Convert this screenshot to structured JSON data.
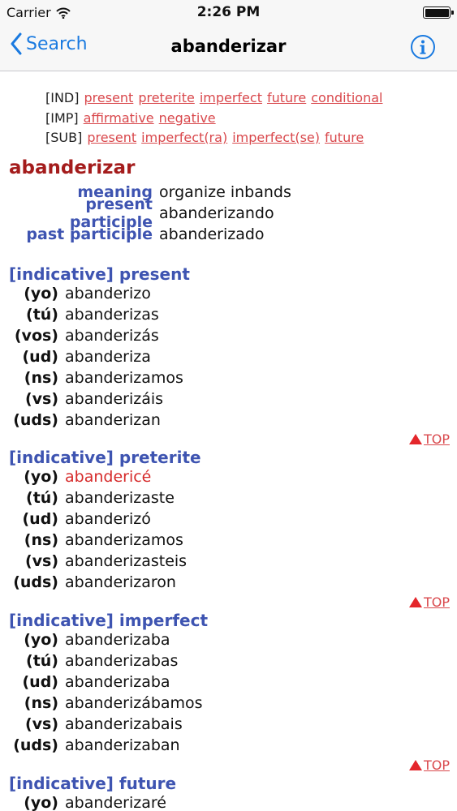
{
  "status_bar": {
    "carrier": "Carrier",
    "time": "2:26 PM"
  },
  "nav": {
    "back_label": "Search",
    "title": "abanderizar"
  },
  "quick_links": [
    {
      "tag": "[IND]",
      "links": [
        "present",
        "preterite",
        "imperfect",
        "future",
        "conditional"
      ]
    },
    {
      "tag": "[IMP]",
      "links": [
        "affirmative",
        "negative"
      ]
    },
    {
      "tag": "[SUB]",
      "links": [
        "present",
        "imperfect(ra)",
        "imperfect(se)",
        "future"
      ]
    }
  ],
  "verb": {
    "title": "abanderizar",
    "info": [
      {
        "label": "meaning",
        "value": "organize inbands"
      },
      {
        "label": "present participle",
        "value": "abanderizando"
      },
      {
        "label": "past participle",
        "value": "abanderizado"
      }
    ]
  },
  "sections": [
    {
      "header": "[indicative] present",
      "rows": [
        {
          "pronoun": "(yo)",
          "form": "abanderizo"
        },
        {
          "pronoun": "(tú)",
          "form": "abanderizas"
        },
        {
          "pronoun": "(vos)",
          "form": "abanderizás"
        },
        {
          "pronoun": "(ud)",
          "form": "abanderiza"
        },
        {
          "pronoun": "(ns)",
          "form": "abanderizamos"
        },
        {
          "pronoun": "(vs)",
          "form": "abanderizáis"
        },
        {
          "pronoun": "(uds)",
          "form": "abanderizan"
        }
      ]
    },
    {
      "header": "[indicative] preterite",
      "rows": [
        {
          "pronoun": "(yo)",
          "form": "abandericé",
          "irregular": true
        },
        {
          "pronoun": "(tú)",
          "form": "abanderizaste"
        },
        {
          "pronoun": "(ud)",
          "form": "abanderizó"
        },
        {
          "pronoun": "(ns)",
          "form": "abanderizamos"
        },
        {
          "pronoun": "(vs)",
          "form": "abanderizasteis"
        },
        {
          "pronoun": "(uds)",
          "form": "abanderizaron"
        }
      ]
    },
    {
      "header": "[indicative] imperfect",
      "rows": [
        {
          "pronoun": "(yo)",
          "form": "abanderizaba"
        },
        {
          "pronoun": "(tú)",
          "form": "abanderizabas"
        },
        {
          "pronoun": "(ud)",
          "form": "abanderizaba"
        },
        {
          "pronoun": "(ns)",
          "form": "abanderizábamos"
        },
        {
          "pronoun": "(vs)",
          "form": "abanderizabais"
        },
        {
          "pronoun": "(uds)",
          "form": "abanderizaban"
        }
      ]
    },
    {
      "header": "[indicative] future",
      "rows": [
        {
          "pronoun": "(yo)",
          "form": "abanderizaré"
        }
      ]
    }
  ],
  "top_link_label": "TOP",
  "colors": {
    "accent": "#1a7ae0",
    "link": "#d9484c",
    "header": "#3e54b1",
    "verb_title": "#a41c1c",
    "irregular": "#d62a2a"
  }
}
